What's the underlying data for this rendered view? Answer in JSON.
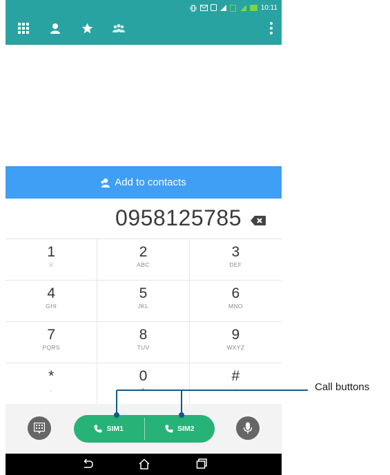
{
  "status_bar": {
    "time": "10:11",
    "icons": [
      "vibrate-icon",
      "message-icon",
      "sim-icon",
      "signal-icon",
      "data-icon",
      "signal-green-icon",
      "battery-charging-icon"
    ]
  },
  "tabs": [
    {
      "icon": "dialpad-grid-icon"
    },
    {
      "icon": "person-icon"
    },
    {
      "icon": "star-icon"
    },
    {
      "icon": "group-icon"
    }
  ],
  "add_contact": {
    "label": "Add to contacts",
    "icon": "add-person-icon"
  },
  "number_display": {
    "value": "0958125785"
  },
  "keypad": [
    {
      "digit": "1",
      "letters": "☉"
    },
    {
      "digit": "2",
      "letters": "ABC"
    },
    {
      "digit": "3",
      "letters": "DEF"
    },
    {
      "digit": "4",
      "letters": "GHI"
    },
    {
      "digit": "5",
      "letters": "JKL"
    },
    {
      "digit": "6",
      "letters": "MNO"
    },
    {
      "digit": "7",
      "letters": "PQRS"
    },
    {
      "digit": "8",
      "letters": "TUV"
    },
    {
      "digit": "9",
      "letters": "WXYZ"
    },
    {
      "digit": "*",
      "letters": ","
    },
    {
      "digit": "0",
      "letters": "+"
    },
    {
      "digit": "#",
      "letters": ";"
    }
  ],
  "call_buttons": {
    "sim1": "SIM1",
    "sim2": "SIM2"
  },
  "annotation": {
    "label": "Call buttons"
  },
  "colors": {
    "teal": "#29a3a1",
    "blue": "#3e9ff5",
    "green": "#27b278",
    "gray": "#666666"
  }
}
